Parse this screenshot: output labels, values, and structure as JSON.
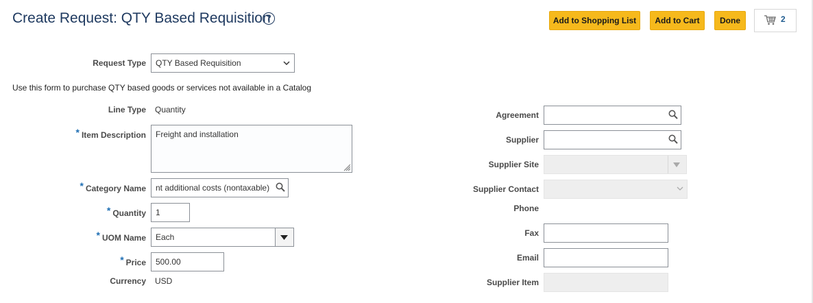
{
  "page": {
    "title": "Create Request: QTY Based Requisition",
    "help_icon": "question-circle-icon"
  },
  "toolbar": {
    "add_to_shopping_list": "Add to Shopping List",
    "add_to_cart": "Add to Cart",
    "done": "Done",
    "cart_icon": "shopping-cart-icon",
    "cart_count": "2"
  },
  "form": {
    "request_type": {
      "label": "Request Type",
      "value": "QTY Based Requisition"
    },
    "instructions": "Use this form to purchase QTY based goods or services not available in a Catalog",
    "line_type": {
      "label": "Line Type",
      "value": "Quantity"
    },
    "item_description": {
      "label": "Item Description",
      "value": "Freight and installation",
      "required": "*"
    },
    "category_name": {
      "label": "Category Name",
      "value": "nt additional costs (nontaxable)",
      "required": "*"
    },
    "quantity": {
      "label": "Quantity",
      "value": "1",
      "required": "*"
    },
    "uom_name": {
      "label": "UOM Name",
      "value": "Each",
      "required": "*"
    },
    "price": {
      "label": "Price",
      "value": "500.00",
      "required": "*"
    },
    "currency": {
      "label": "Currency",
      "value": "USD"
    },
    "agreement": {
      "label": "Agreement",
      "value": ""
    },
    "supplier": {
      "label": "Supplier",
      "value": ""
    },
    "supplier_site": {
      "label": "Supplier Site",
      "value": ""
    },
    "supplier_contact": {
      "label": "Supplier Contact",
      "value": ""
    },
    "phone": {
      "label": "Phone"
    },
    "fax": {
      "label": "Fax",
      "value": ""
    },
    "email": {
      "label": "Email",
      "value": ""
    },
    "supplier_item": {
      "label": "Supplier Item",
      "value": ""
    }
  },
  "colors": {
    "title": "#1f3a60",
    "button": "#f6b91c",
    "required_star": "#1f6fb4",
    "disabled_field": "#eeeeee"
  }
}
